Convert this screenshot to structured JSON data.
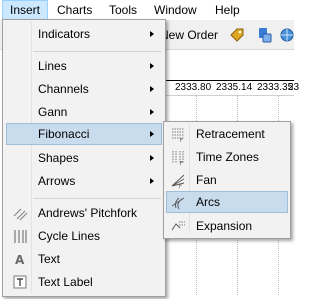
{
  "menubar": {
    "items": [
      {
        "label": "Insert"
      },
      {
        "label": "Charts"
      },
      {
        "label": "Tools"
      },
      {
        "label": "Window"
      },
      {
        "label": "Help"
      }
    ]
  },
  "toolbar": {
    "new_order_fragment": "New Order"
  },
  "price_axis": {
    "ticks": [
      "2333.80",
      "2335.14",
      "2333.35",
      "23"
    ]
  },
  "insert_menu": {
    "items": [
      {
        "label": "Indicators",
        "has_submenu": true
      },
      {
        "label": "Lines",
        "has_submenu": true
      },
      {
        "label": "Channels",
        "has_submenu": true
      },
      {
        "label": "Gann",
        "has_submenu": true
      },
      {
        "label": "Fibonacci",
        "has_submenu": true,
        "highlighted": true
      },
      {
        "label": "Shapes",
        "has_submenu": true
      },
      {
        "label": "Arrows",
        "has_submenu": true
      },
      {
        "label": "Andrews' Pitchfork",
        "icon": "pitchfork-icon"
      },
      {
        "label": "Cycle Lines",
        "icon": "cycle-lines-icon"
      },
      {
        "label": "Text",
        "icon": "text-icon"
      },
      {
        "label": "Text Label",
        "icon": "text-label-icon"
      }
    ]
  },
  "fibonacci_submenu": {
    "items": [
      {
        "label": "Retracement",
        "icon": "fibo-retracement-icon"
      },
      {
        "label": "Time Zones",
        "icon": "fibo-time-zones-icon"
      },
      {
        "label": "Fan",
        "icon": "fibo-fan-icon"
      },
      {
        "label": "Arcs",
        "icon": "fibo-arcs-icon",
        "highlighted": true
      },
      {
        "label": "Expansion",
        "icon": "fibo-expansion-icon"
      }
    ]
  },
  "colors": {
    "highlight": "#c9dcee",
    "highlight_border": "#9fbcd8",
    "menu_bg": "#f2f2f2",
    "menubar_active": "#cce8ff"
  }
}
